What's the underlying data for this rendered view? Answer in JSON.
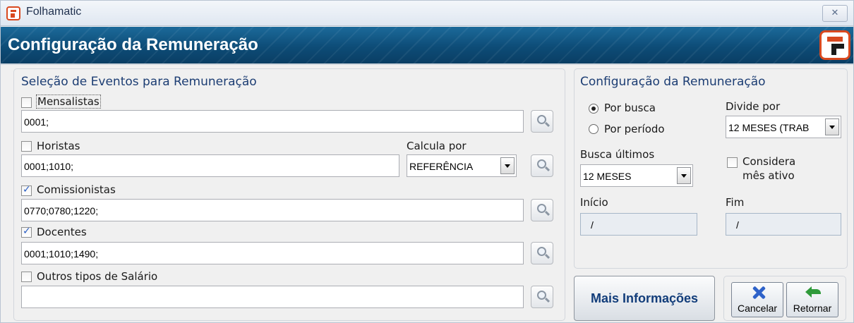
{
  "window": {
    "title": "Folhamatic",
    "close_glyph": "✕"
  },
  "header": {
    "title": "Configuração da Remuneração"
  },
  "left_panel": {
    "title": "Seleção de Eventos para Remuneração",
    "mensalistas": {
      "label": "Mensalistas",
      "checked": false,
      "value": "0001;"
    },
    "horistas": {
      "label": "Horistas",
      "checked": false,
      "value": "0001;1010;"
    },
    "calcula_por": {
      "label": "Calcula por",
      "value": "REFERÊNCIA"
    },
    "comissionistas": {
      "label": "Comissionistas",
      "checked": true,
      "value": "0770;0780;1220;"
    },
    "docentes": {
      "label": "Docentes",
      "checked": true,
      "value": "0001;1010;1490;"
    },
    "outros": {
      "label": "Outros tipos de Salário",
      "checked": false,
      "value": ""
    }
  },
  "right_panel": {
    "title": "Configuração da Remuneração",
    "radio_busca": {
      "label": "Por busca",
      "selected": true
    },
    "radio_periodo": {
      "label": "Por período",
      "selected": false
    },
    "divide_por": {
      "label": "Divide por",
      "value": "12 MESES (TRAB"
    },
    "busca_ultimos": {
      "label": "Busca últimos",
      "value": "12 MESES"
    },
    "considera": {
      "label_line1": "Considera",
      "label_line2": "mês ativo",
      "checked": false
    },
    "inicio": {
      "label": "Início",
      "value": "/"
    },
    "fim": {
      "label": "Fim",
      "value": "/"
    }
  },
  "buttons": {
    "mais_informacoes": "Mais Informações",
    "cancelar": "Cancelar",
    "retornar": "Retornar"
  },
  "colors": {
    "header": "#0d4c77",
    "accent_logo": "#d9491f",
    "panel_title": "#1c3d73"
  }
}
